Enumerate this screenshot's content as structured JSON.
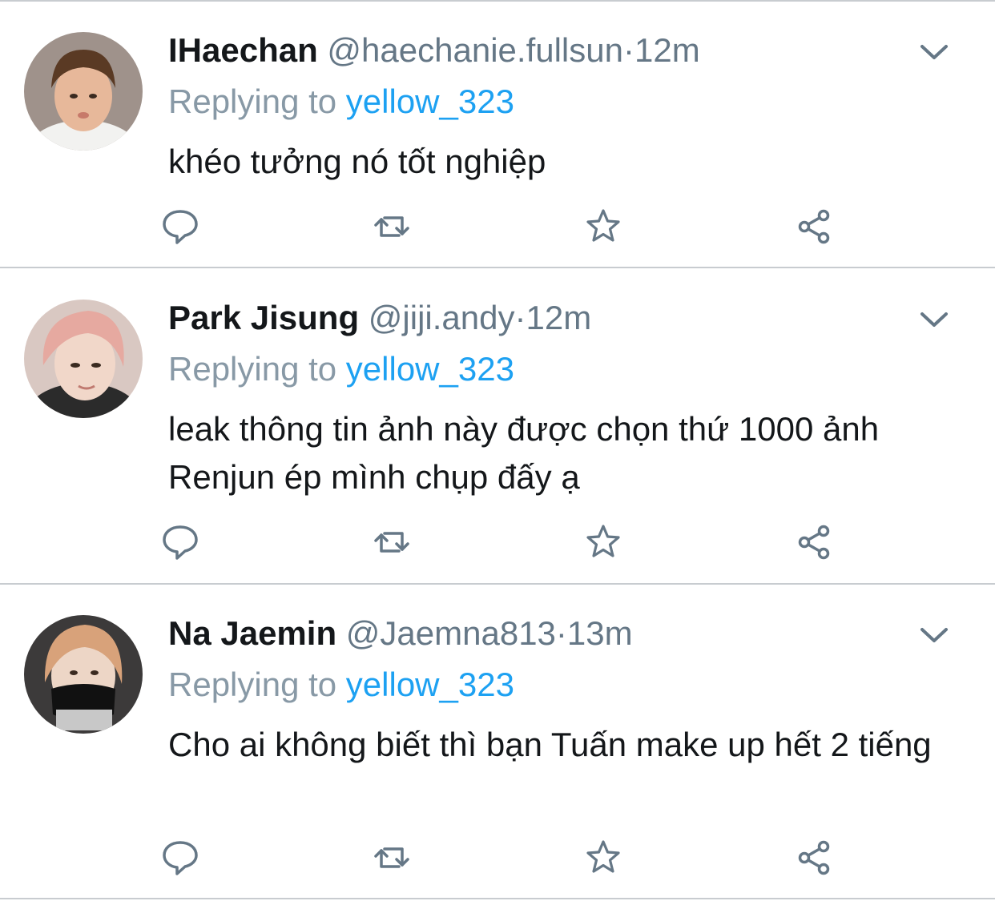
{
  "tweets": [
    {
      "name": "IHaechan",
      "handle": "@haechanie.fullsun",
      "dot": "·",
      "time": "12m",
      "reply_prefix": "Replying to",
      "reply_user": "yellow_323",
      "text": "khéo tưởng nó tốt nghiệp"
    },
    {
      "name": "Park Jisung",
      "handle": "@jiji.andy",
      "dot": "·",
      "time": "12m",
      "reply_prefix": "Replying to",
      "reply_user": "yellow_323",
      "text": "leak thông tin ảnh này được chọn thứ 1000 ảnh Renjun ép mình chụp đấy ạ"
    },
    {
      "name": "Na Jaemin",
      "handle": "@Jaemna813",
      "dot": "·",
      "time": "13m",
      "reply_prefix": "Replying to",
      "reply_user": "yellow_323",
      "text": "Cho ai không biết thì bạn Tuấn make up hết 2 tiếng"
    }
  ],
  "icons": {
    "reply": "reply-icon",
    "retweet": "retweet-icon",
    "like": "star-icon",
    "share": "share-icon",
    "more": "chevron-down-icon"
  },
  "colors": {
    "name": "#14171a",
    "meta": "#657786",
    "link": "#1da1f2",
    "reply_prefix": "#8899a6",
    "icon": "#657786",
    "divider": "#c8ccd0"
  }
}
